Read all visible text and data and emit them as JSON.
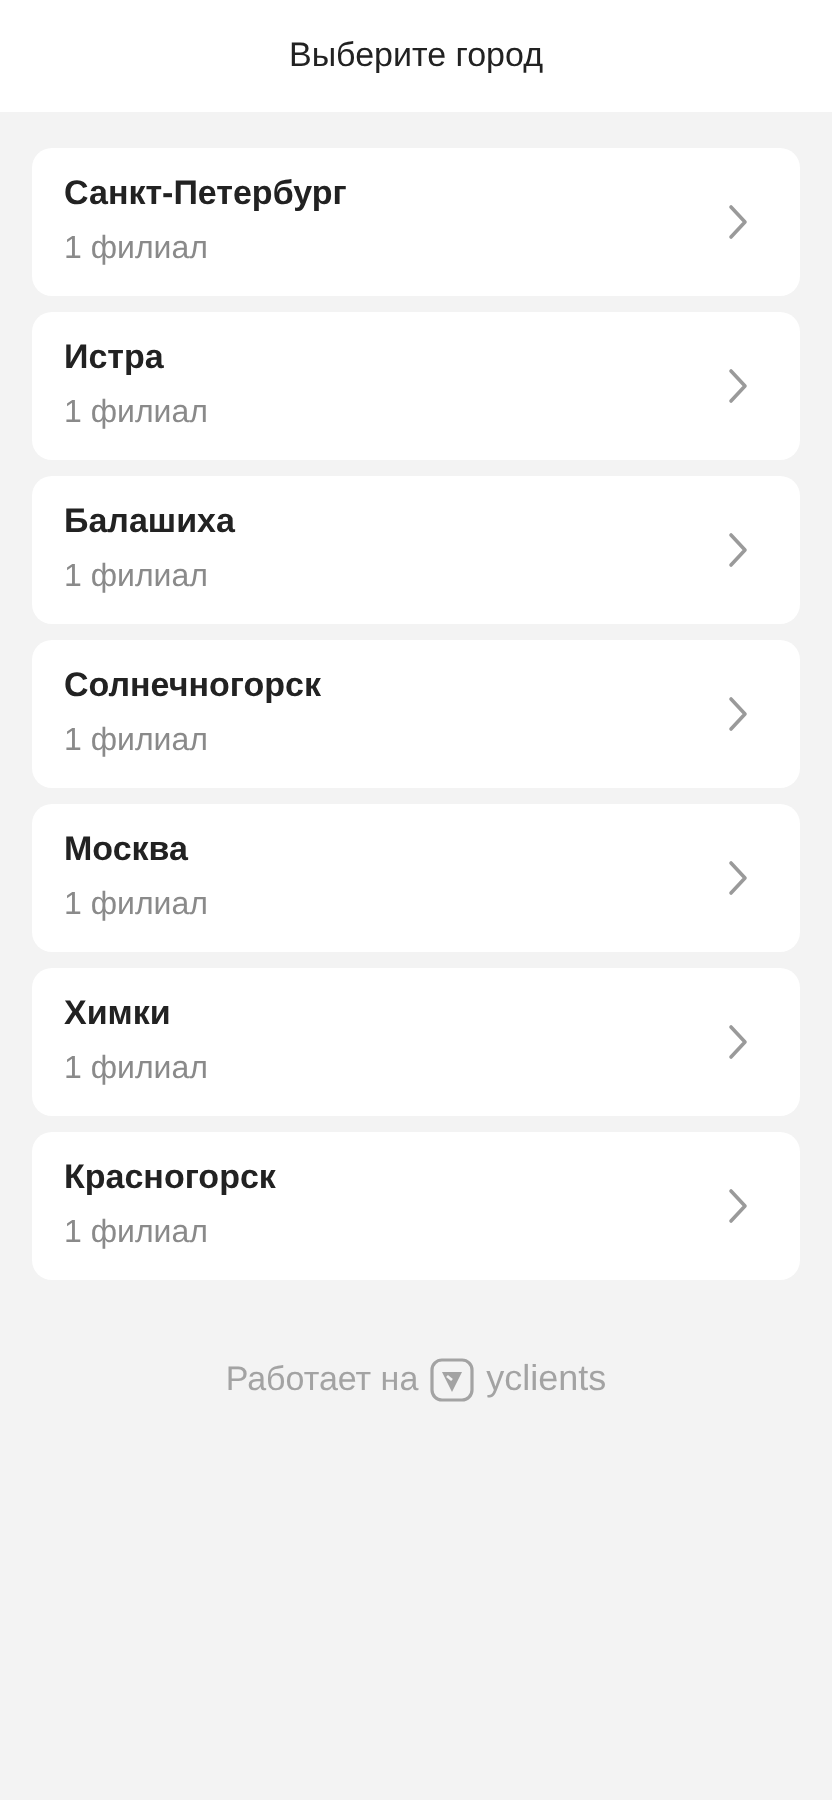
{
  "header": {
    "title": "Выберите город"
  },
  "cities": [
    {
      "name": "Санкт-Петербург",
      "branches": "1 филиал"
    },
    {
      "name": "Истра",
      "branches": "1 филиал"
    },
    {
      "name": "Балашиха",
      "branches": "1 филиал"
    },
    {
      "name": "Солнечногорск",
      "branches": "1 филиал"
    },
    {
      "name": "Москва",
      "branches": "1 филиал"
    },
    {
      "name": "Химки",
      "branches": "1 филиал"
    },
    {
      "name": "Красногорск",
      "branches": "1 филиал"
    }
  ],
  "footer": {
    "text": "Работает на",
    "brand": "yclients"
  }
}
